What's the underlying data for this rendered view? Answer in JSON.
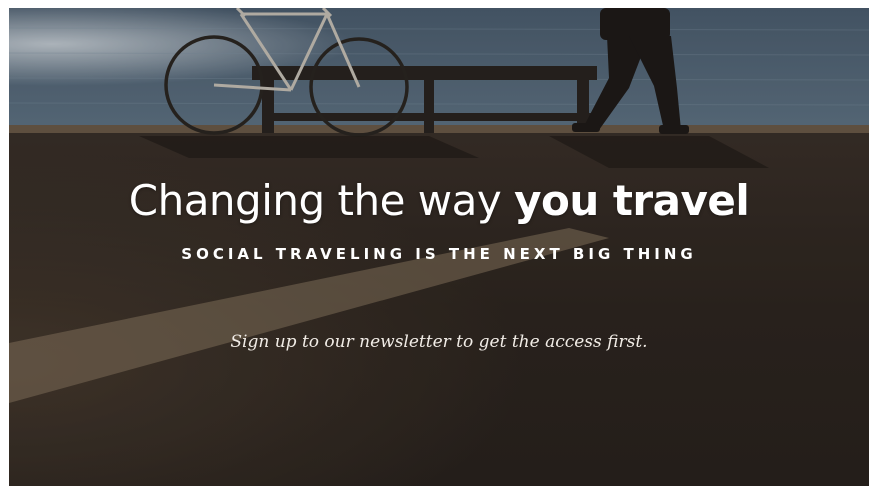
{
  "hero": {
    "headline_regular": "Changing the way ",
    "headline_bold": "you travel",
    "subheadline": "SOCIAL TRAVELING IS THE NEXT BIG THING",
    "newsletter_prompt": "Sign up to our newsletter to get the access first."
  },
  "background": {
    "scene": "seaside promenade with bicycle, bench and walking person",
    "colors": {
      "sea": "#4a5e73",
      "pavement": "#2e2620",
      "road_marking": "#8c7a63"
    }
  }
}
